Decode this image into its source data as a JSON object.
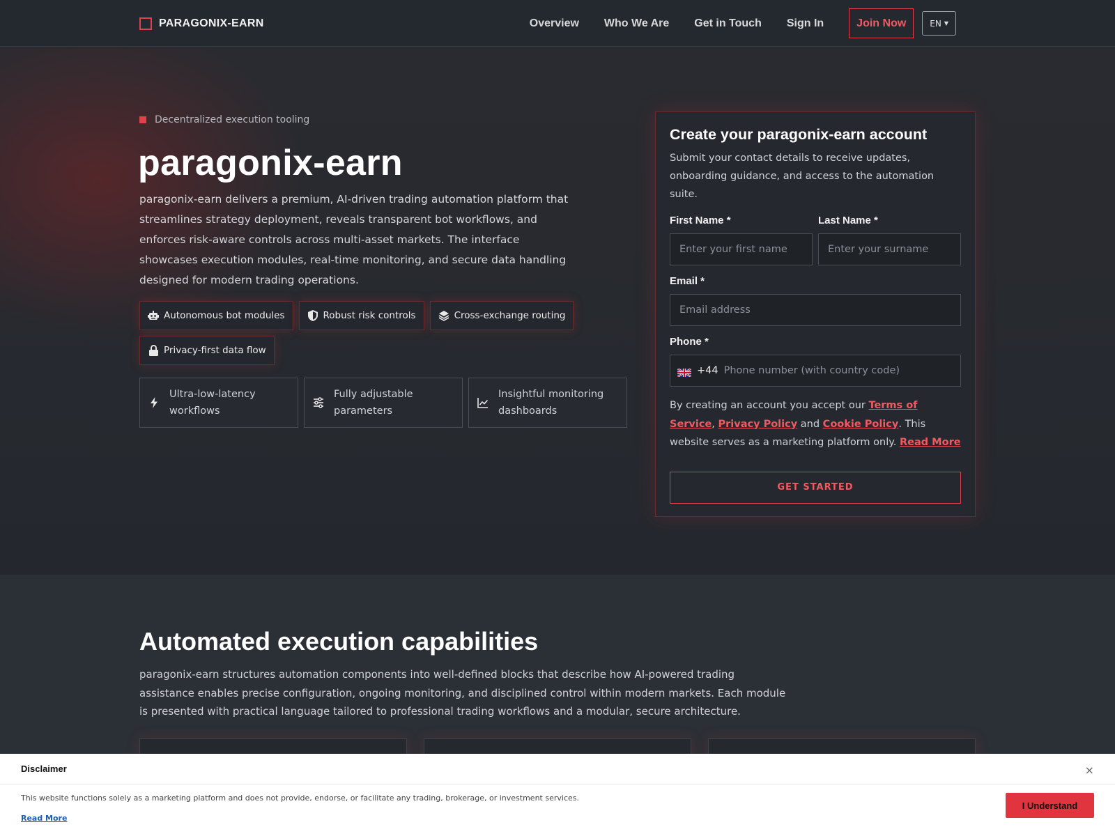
{
  "header": {
    "brand": "PARAGONIX-EARN",
    "nav": [
      "Overview",
      "Who We Are",
      "Get in Touch",
      "Sign In"
    ],
    "join_label": "Join Now",
    "lang": "EN"
  },
  "hero": {
    "eyebrow": "Decentralized execution tooling",
    "title": "paragonix-earn",
    "description": "paragonix-earn delivers a premium, AI-driven trading automation platform that streamlines strategy deployment, reveals transparent bot workflows, and enforces risk-aware controls across multi-asset markets. The interface showcases execution modules, real-time monitoring, and secure data handling designed for modern trading operations.",
    "chips": [
      {
        "label": "Autonomous bot modules",
        "icon": "robot-icon"
      },
      {
        "label": "Robust risk controls",
        "icon": "shield-icon"
      },
      {
        "label": "Cross-exchange routing",
        "icon": "layers-icon"
      },
      {
        "label": "Privacy-first data flow",
        "icon": "lock-icon"
      }
    ],
    "features": [
      {
        "label": "Ultra-low-latency workflows",
        "icon": "bolt-icon"
      },
      {
        "label": "Fully adjustable parameters",
        "icon": "sliders-icon"
      },
      {
        "label": "Insightful monitoring dashboards",
        "icon": "chart-line-icon"
      }
    ]
  },
  "form": {
    "title": "Create your paragonix-earn account",
    "subtitle": "Submit your contact details to receive updates, onboarding guidance, and access to the automation suite.",
    "first_name_label": "First Name *",
    "first_name_placeholder": "Enter your first name",
    "last_name_label": "Last Name *",
    "last_name_placeholder": "Enter your surname",
    "email_label": "Email *",
    "email_placeholder": "Email address",
    "phone_label": "Phone *",
    "phone_dial": "+44",
    "phone_placeholder": "Phone number (with country code)",
    "terms_prefix": "By creating an account you accept our",
    "terms_link": "Terms of Service",
    "privacy_link": "Privacy Policy",
    "and_text": "and",
    "cookie_link": "Cookie Policy",
    "terms_suffix": ". This website serves as a marketing platform only.",
    "read_more": "Read More",
    "cta": "GET STARTED"
  },
  "section2": {
    "title": "Automated execution capabilities",
    "description": "paragonix-earn structures automation components into well-defined blocks that describe how AI-powered trading assistance enables precise configuration, ongoing monitoring, and disciplined control within modern markets. Each module is presented with practical language tailored to professional trading workflows and a modular, secure architecture."
  },
  "disclaimer": {
    "title": "Disclaimer",
    "close": "×",
    "text": "This website functions solely as a marketing platform and does not provide, endorse, or facilitate any trading, brokerage, or investment services.",
    "read_more": "Read More",
    "button": "I Understand"
  },
  "colors": {
    "accent": "#e0414a",
    "background": "#262b31",
    "card": "#25292f"
  }
}
